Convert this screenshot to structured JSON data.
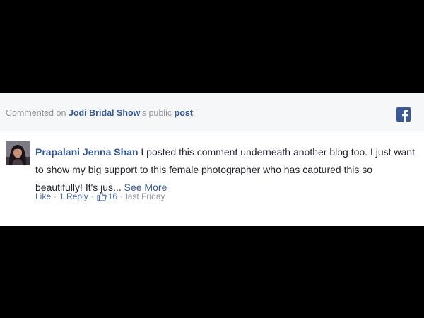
{
  "context": {
    "prefix": "Commented on ",
    "page_name": "Jodi Bridal Show",
    "middle": "'s public ",
    "post_link": "post"
  },
  "icons": {
    "facebook": "facebook-icon",
    "like": "thumbs-up-icon",
    "avatar": "profile-photo"
  },
  "comment": {
    "author": "Prapalani Jenna Shan",
    "text": " I posted this comment underneath another blog too. I just want to show my big support to this female photographer who has captured this so beautifully! It's jus... ",
    "see_more": "See More"
  },
  "actions": {
    "like_label": "Like",
    "reply_label": "1 Reply",
    "like_count": "16",
    "timestamp": "last Friday",
    "separator": "·"
  },
  "colors": {
    "link_blue": "#365899",
    "facebook_blue": "#3b5998",
    "meta_gray": "#90949c",
    "text": "#1d2129"
  }
}
